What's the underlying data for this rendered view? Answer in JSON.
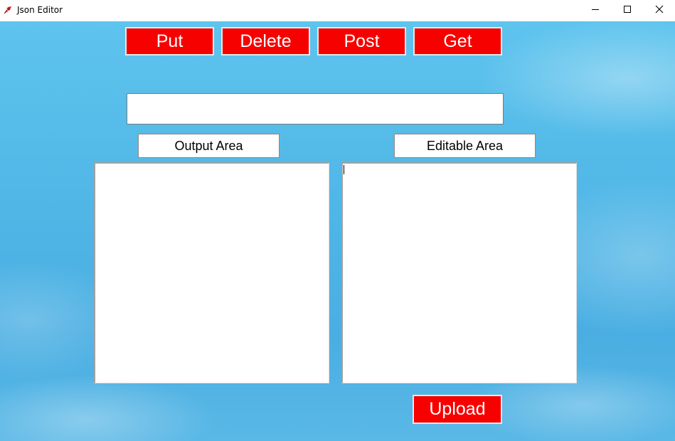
{
  "window": {
    "title": "Json Editor",
    "icon": "feather-icon",
    "controls": {
      "minimize_icon": "minimize-icon",
      "maximize_icon": "maximize-icon",
      "close_icon": "close-icon"
    }
  },
  "toolbar": {
    "put_label": "Put",
    "delete_label": "Delete",
    "post_label": "Post",
    "get_label": "Get"
  },
  "url_input": {
    "value": "",
    "placeholder": ""
  },
  "output_area": {
    "label": "Output Area",
    "value": ""
  },
  "editable_area": {
    "label": "Editable Area",
    "value": ""
  },
  "upload_label": "Upload",
  "colors": {
    "button_bg": "#f70000",
    "button_text": "#ffffff",
    "sky": "#4fb6e6"
  }
}
